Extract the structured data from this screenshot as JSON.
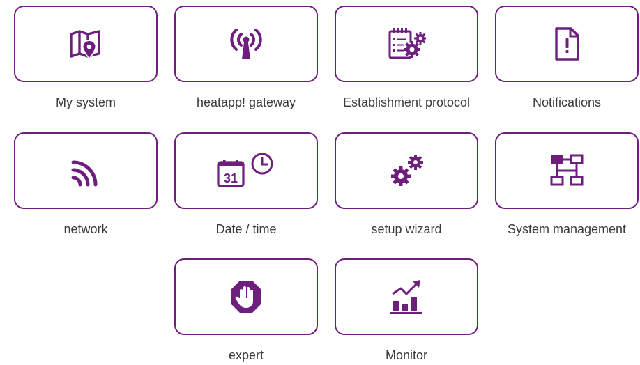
{
  "colors": {
    "accent": "#6e1f7e",
    "label_text": "#3a3a3a",
    "background": "#ffffff"
  },
  "tiles": [
    {
      "label": "My system",
      "icon": "map-pin-icon"
    },
    {
      "label": "heatapp! gateway",
      "icon": "antenna-broadcast-icon"
    },
    {
      "label": "Establishment protocol",
      "icon": "notepad-gears-icon"
    },
    {
      "label": "Notifications",
      "icon": "document-alert-icon"
    },
    {
      "label": "network",
      "icon": "wireless-signal-icon"
    },
    {
      "label": "Date / time",
      "icon": "calendar-clock-icon"
    },
    {
      "label": "setup wizard",
      "icon": "gears-icon"
    },
    {
      "label": "System management",
      "icon": "network-hierarchy-icon"
    },
    {
      "label": "expert",
      "icon": "stop-hand-icon"
    },
    {
      "label": "Monitor",
      "icon": "bar-chart-trend-icon"
    }
  ]
}
